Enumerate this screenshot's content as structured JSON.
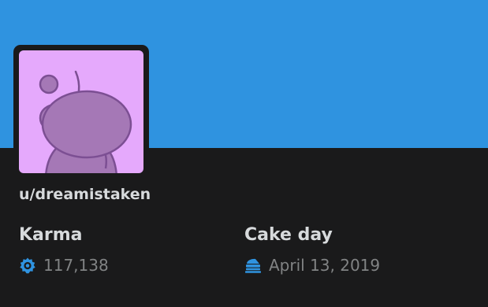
{
  "profile": {
    "username": "u/dreamistaken",
    "avatar_icon": "snoo-avatar-icon",
    "banner_color": "#2f93e0",
    "avatar_bg_color": "#e5a9fc"
  },
  "stats": {
    "karma": {
      "title": "Karma",
      "value": "117,138",
      "icon": "karma-icon",
      "icon_color": "#2f93e0"
    },
    "cake_day": {
      "title": "Cake day",
      "value": "April 13, 2019",
      "icon": "cake-icon",
      "icon_color": "#2f93e0"
    }
  }
}
